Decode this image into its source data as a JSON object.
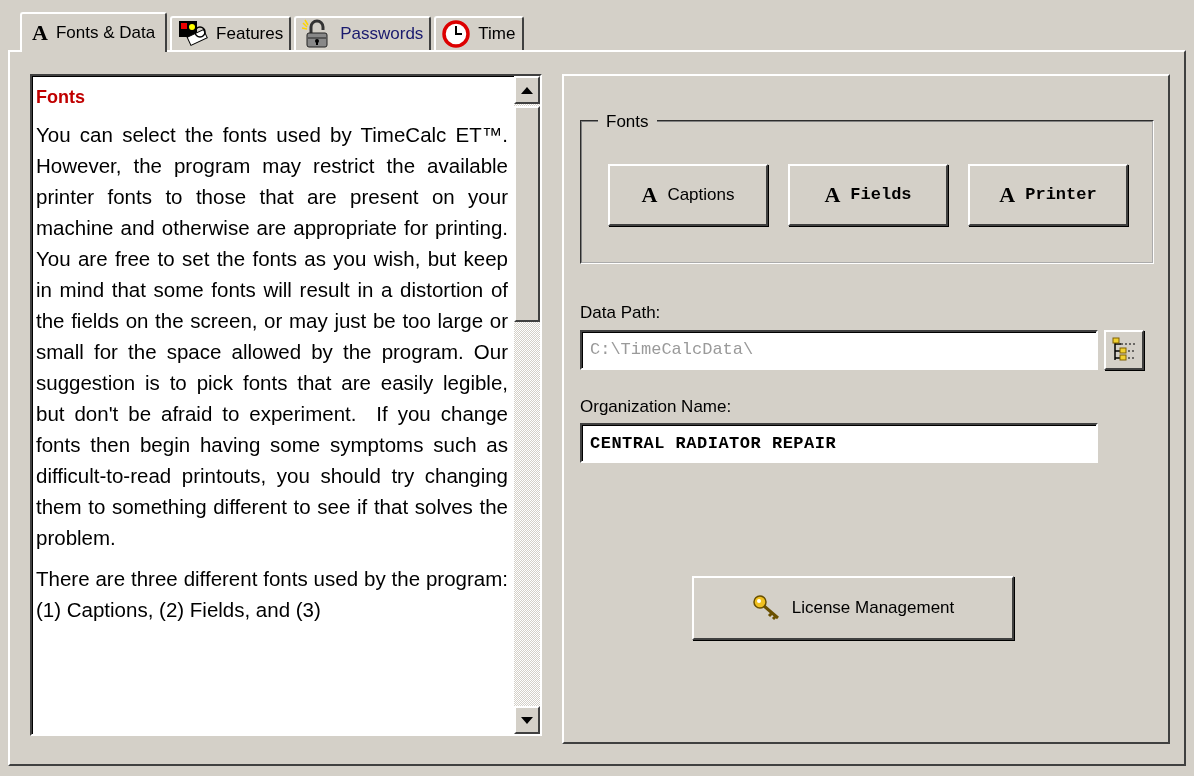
{
  "tabs": [
    {
      "label": "Fonts & Data",
      "icon": "A",
      "selected": true,
      "hovered": false
    },
    {
      "label": "Features",
      "selected": false,
      "hovered": false
    },
    {
      "label": "Passwords",
      "selected": false,
      "hovered": true
    },
    {
      "label": "Time",
      "selected": false,
      "hovered": false
    }
  ],
  "help": {
    "heading": "Fonts",
    "paragraphs": [
      "You can select the fonts used by TimeCalc ET™.  However, the program may restrict the available printer fonts to those that are present on your machine and otherwise are appropriate for printing. You are free to set the fonts as you wish, but keep in mind that some fonts will result in a distortion of the fields on the screen, or may just be too large or small for the space allowed by the program. Our suggestion is to pick fonts that are easily legible, but don't be afraid to experiment.  If you change fonts then begin having some symptoms such as difficult-to-read printouts, you should try changing them to something different to see if that solves the problem.",
      "There are three different fonts used by the program:  (1) Captions, (2) Fields, and (3)"
    ]
  },
  "fonts_group": {
    "title": "Fonts",
    "buttons": [
      {
        "icon": "A",
        "label": "Captions"
      },
      {
        "icon": "A",
        "label": "Fields"
      },
      {
        "icon": "A",
        "label": "Printer"
      }
    ]
  },
  "data_path": {
    "label": "Data Path:",
    "value": "C:\\TimeCalcData\\",
    "disabled": true
  },
  "organization": {
    "label": "Organization Name:",
    "value": "CENTRAL RADIATOR REPAIR",
    "disabled": false
  },
  "license_button": {
    "label": "License Management"
  }
}
